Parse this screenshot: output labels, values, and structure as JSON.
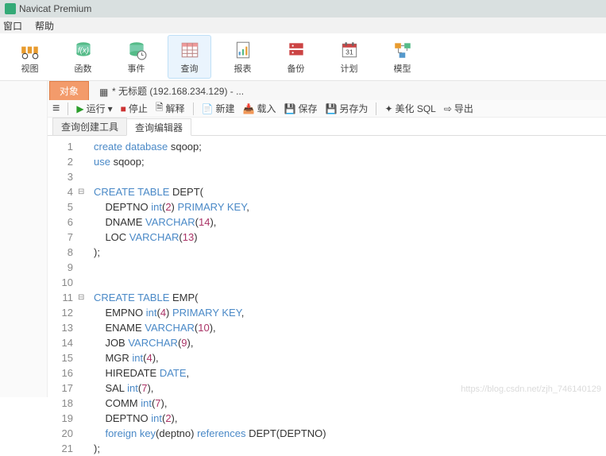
{
  "title": "Navicat Premium",
  "menu": {
    "window": "窗口",
    "help": "帮助"
  },
  "ribbon": [
    {
      "id": "view",
      "label": "视图"
    },
    {
      "id": "function",
      "label": "函数"
    },
    {
      "id": "event",
      "label": "事件"
    },
    {
      "id": "query",
      "label": "查询",
      "active": true
    },
    {
      "id": "report",
      "label": "报表"
    },
    {
      "id": "backup",
      "label": "备份"
    },
    {
      "id": "plan",
      "label": "计划"
    },
    {
      "id": "model",
      "label": "模型"
    }
  ],
  "filetabs": [
    {
      "id": "objects",
      "label": "对象",
      "icon": "",
      "selected": true
    },
    {
      "id": "untitled",
      "label": "* 无标题 (192.168.234.129) - ...",
      "icon": "query"
    }
  ],
  "actions": {
    "hamburger": "≡",
    "run": "运行",
    "stop": "停止",
    "explain": "解释",
    "new": "新建",
    "load": "载入",
    "save": "保存",
    "saveas": "另存为",
    "beautify": "美化 SQL",
    "export": "导出"
  },
  "innertabs": [
    {
      "id": "builder",
      "label": "查询创建工具"
    },
    {
      "id": "editor",
      "label": "查询编辑器",
      "selected": true
    }
  ],
  "code": {
    "lines": [
      {
        "n": 1,
        "fold": "",
        "tokens": [
          {
            "t": "kw",
            "v": "create database"
          },
          {
            "t": "id",
            "v": " sqoop;"
          }
        ]
      },
      {
        "n": 2,
        "fold": "",
        "tokens": [
          {
            "t": "kw",
            "v": "use"
          },
          {
            "t": "id",
            "v": " sqoop;"
          }
        ]
      },
      {
        "n": 3,
        "fold": "",
        "tokens": []
      },
      {
        "n": 4,
        "fold": "⊟",
        "tokens": [
          {
            "t": "kw",
            "v": "CREATE TABLE"
          },
          {
            "t": "id",
            "v": " DEPT("
          }
        ]
      },
      {
        "n": 5,
        "fold": "",
        "tokens": [
          {
            "t": "id",
            "v": "    DEPTNO "
          },
          {
            "t": "kw",
            "v": "int"
          },
          {
            "t": "id",
            "v": "("
          },
          {
            "t": "num",
            "v": "2"
          },
          {
            "t": "id",
            "v": ") "
          },
          {
            "t": "kw",
            "v": "PRIMARY KEY"
          },
          {
            "t": "id",
            "v": ","
          }
        ]
      },
      {
        "n": 6,
        "fold": "",
        "tokens": [
          {
            "t": "id",
            "v": "    DNAME "
          },
          {
            "t": "kw",
            "v": "VARCHAR"
          },
          {
            "t": "id",
            "v": "("
          },
          {
            "t": "num",
            "v": "14"
          },
          {
            "t": "id",
            "v": "),"
          }
        ]
      },
      {
        "n": 7,
        "fold": "",
        "tokens": [
          {
            "t": "id",
            "v": "    LOC "
          },
          {
            "t": "kw",
            "v": "VARCHAR"
          },
          {
            "t": "id",
            "v": "("
          },
          {
            "t": "num",
            "v": "13"
          },
          {
            "t": "id",
            "v": ")"
          }
        ]
      },
      {
        "n": 8,
        "fold": "",
        "tokens": [
          {
            "t": "id",
            "v": ");"
          }
        ]
      },
      {
        "n": 9,
        "fold": "",
        "tokens": []
      },
      {
        "n": 10,
        "fold": "",
        "tokens": []
      },
      {
        "n": 11,
        "fold": "⊟",
        "tokens": [
          {
            "t": "kw",
            "v": "CREATE TABLE"
          },
          {
            "t": "id",
            "v": " EMP("
          }
        ]
      },
      {
        "n": 12,
        "fold": "",
        "tokens": [
          {
            "t": "id",
            "v": "    EMPNO "
          },
          {
            "t": "kw",
            "v": "int"
          },
          {
            "t": "id",
            "v": "("
          },
          {
            "t": "num",
            "v": "4"
          },
          {
            "t": "id",
            "v": ") "
          },
          {
            "t": "kw",
            "v": "PRIMARY KEY"
          },
          {
            "t": "id",
            "v": ","
          }
        ]
      },
      {
        "n": 13,
        "fold": "",
        "tokens": [
          {
            "t": "id",
            "v": "    ENAME "
          },
          {
            "t": "kw",
            "v": "VARCHAR"
          },
          {
            "t": "id",
            "v": "("
          },
          {
            "t": "num",
            "v": "10"
          },
          {
            "t": "id",
            "v": "),"
          }
        ]
      },
      {
        "n": 14,
        "fold": "",
        "tokens": [
          {
            "t": "id",
            "v": "    JOB "
          },
          {
            "t": "kw",
            "v": "VARCHAR"
          },
          {
            "t": "id",
            "v": "("
          },
          {
            "t": "num",
            "v": "9"
          },
          {
            "t": "id",
            "v": "),"
          }
        ]
      },
      {
        "n": 15,
        "fold": "",
        "tokens": [
          {
            "t": "id",
            "v": "    MGR "
          },
          {
            "t": "kw",
            "v": "int"
          },
          {
            "t": "id",
            "v": "("
          },
          {
            "t": "num",
            "v": "4"
          },
          {
            "t": "id",
            "v": "),"
          }
        ]
      },
      {
        "n": 16,
        "fold": "",
        "tokens": [
          {
            "t": "id",
            "v": "    HIREDATE "
          },
          {
            "t": "kw",
            "v": "DATE"
          },
          {
            "t": "id",
            "v": ","
          }
        ]
      },
      {
        "n": 17,
        "fold": "",
        "tokens": [
          {
            "t": "id",
            "v": "    SAL "
          },
          {
            "t": "kw",
            "v": "int"
          },
          {
            "t": "id",
            "v": "("
          },
          {
            "t": "num",
            "v": "7"
          },
          {
            "t": "id",
            "v": "),"
          }
        ]
      },
      {
        "n": 18,
        "fold": "",
        "tokens": [
          {
            "t": "id",
            "v": "    COMM "
          },
          {
            "t": "kw",
            "v": "int"
          },
          {
            "t": "id",
            "v": "("
          },
          {
            "t": "num",
            "v": "7"
          },
          {
            "t": "id",
            "v": "),"
          }
        ]
      },
      {
        "n": 19,
        "fold": "",
        "tokens": [
          {
            "t": "id",
            "v": "    DEPTNO "
          },
          {
            "t": "kw",
            "v": "int"
          },
          {
            "t": "id",
            "v": "("
          },
          {
            "t": "num",
            "v": "2"
          },
          {
            "t": "id",
            "v": "),"
          }
        ]
      },
      {
        "n": 20,
        "fold": "",
        "tokens": [
          {
            "t": "id",
            "v": "    "
          },
          {
            "t": "kw",
            "v": "foreign key"
          },
          {
            "t": "id",
            "v": "(deptno) "
          },
          {
            "t": "kw",
            "v": "references"
          },
          {
            "t": "id",
            "v": " DEPT(DEPTNO)"
          }
        ]
      },
      {
        "n": 21,
        "fold": "",
        "tokens": [
          {
            "t": "id",
            "v": ");"
          }
        ]
      }
    ]
  },
  "watermark": "https://blog.csdn.net/zjh_746140129"
}
